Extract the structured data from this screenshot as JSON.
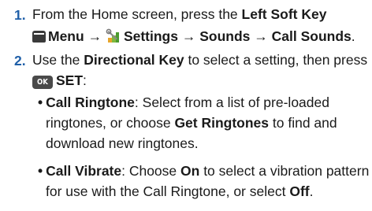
{
  "steps": [
    {
      "number": "1.",
      "line1": {
        "text_a": "From the Home screen, press the ",
        "bold_a": "Left Soft Key"
      },
      "line2": {
        "icon_menu": "menu-soft-key-icon",
        "bold_menu": "Menu",
        "arrow1": " → ",
        "icon_settings": "settings-wrench-icon",
        "bold_settings": "Settings",
        "arrow2": " → ",
        "bold_sounds": "Sounds",
        "arrow3": " → ",
        "bold_call_sounds": "Call Sounds",
        "end": "."
      }
    },
    {
      "number": "2.",
      "line1": {
        "text_a": "Use the ",
        "bold_a": "Directional Key",
        "text_b": " to select a setting, then press"
      },
      "line2": {
        "ok_label": "OK",
        "bold_set": "SET",
        "end": ":"
      }
    }
  ],
  "bullets": [
    {
      "symbol": "•",
      "title": "Call Ringtone",
      "lines": [
        {
          "pre": ": Select from a list of pre-loaded"
        },
        {
          "pre": "ringtones, or choose ",
          "bold": "Get Ringtones",
          "post": " to find and"
        },
        {
          "pre": "download new ringtones."
        }
      ]
    },
    {
      "symbol": "•",
      "title": "Call Vibrate",
      "lines": [
        {
          "pre": ": Choose ",
          "bold": "On",
          "post": " to select a vibration pattern"
        },
        {
          "pre": "for use with the Call Ringtone, or select ",
          "bold": "Off",
          "post": "."
        }
      ]
    }
  ],
  "colors": {
    "step_number": "#1f5fa8",
    "text": "#1a1a1a",
    "icon_dark": "#3a3a3a"
  }
}
